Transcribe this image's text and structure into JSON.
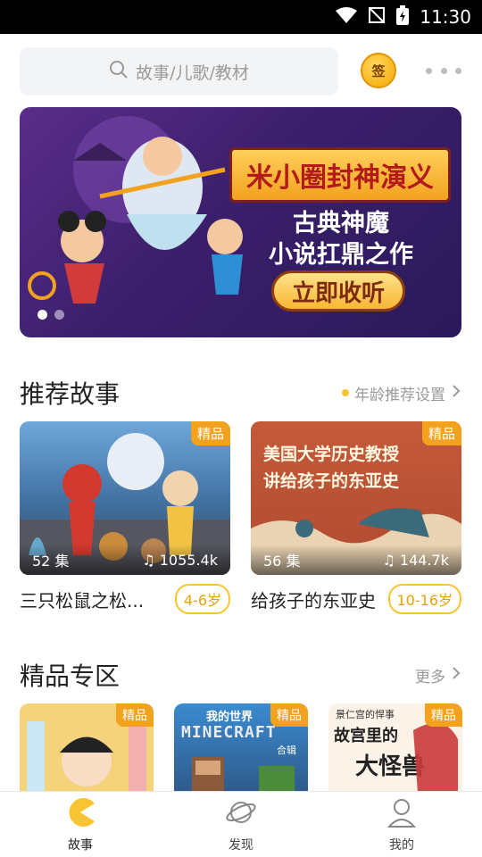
{
  "status_bar": {
    "time": "11:30"
  },
  "search": {
    "placeholder": "故事/儿歌/教材"
  },
  "sign_in": {
    "label": "签"
  },
  "banner": {
    "title": "米小圈封神演义",
    "line1": "古典神魔",
    "line2": "小说扛鼎之作",
    "cta": "立即收听",
    "slides": 2,
    "active_slide": 1
  },
  "recommend": {
    "title": "推荐故事",
    "link": "年龄推荐设置",
    "cards": [
      {
        "name": "三只松鼠之松...",
        "age": "4-6岁",
        "episodes": "52 集",
        "plays": "1055.4k",
        "tag": "精品"
      },
      {
        "name": "给孩子的东亚史",
        "age": "10-16岁",
        "episodes": "56 集",
        "plays": "144.7k",
        "tag": "精品",
        "cover_text_1": "美国大学历史教授",
        "cover_text_2": "讲给孩子的东亚史"
      }
    ]
  },
  "premium": {
    "title": "精品专区",
    "link": "更多",
    "items": [
      {
        "tag": "精品"
      },
      {
        "tag": "精品",
        "cover_text_1": "我的世界",
        "cover_text_2": "MINECRAFT",
        "cover_text_3": "合辑"
      },
      {
        "tag": "精品",
        "cover_text_1": "景仁宫的悍事",
        "cover_text_2": "故宫里的",
        "cover_text_3": "大怪兽"
      }
    ]
  },
  "tabs": [
    {
      "label": "故事",
      "active": true
    },
    {
      "label": "发现",
      "active": false
    },
    {
      "label": "我的",
      "active": false
    }
  ],
  "colors": {
    "accent": "#f7c531",
    "tag": "#f2a21f",
    "banner_bg": "#3b1f6b"
  }
}
